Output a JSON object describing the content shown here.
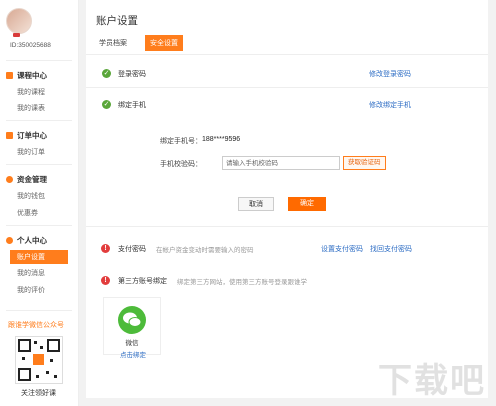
{
  "sidebar": {
    "user_id": "ID:350025688",
    "sections": [
      {
        "title": "课程中心",
        "items": [
          "我的课程",
          "我的课表"
        ]
      },
      {
        "title": "订单中心",
        "items": [
          "我的订单"
        ]
      },
      {
        "title": "资金管理",
        "items": [
          "我的钱包",
          "优惠券"
        ]
      },
      {
        "title": "个人中心",
        "items": [
          "账户设置",
          "我的消息",
          "我的评价"
        ]
      }
    ],
    "active_item": "账户设置",
    "wechat_title": "跟谁学微信公众号",
    "follow_text": "关注领好课"
  },
  "main": {
    "title": "账户设置",
    "tabs": [
      "学员档案",
      "安全设置"
    ],
    "active_tab": "安全设置",
    "login_password": {
      "label": "登录密码",
      "link": "修改登录密码"
    },
    "bind_phone": {
      "label": "绑定手机",
      "link": "修改绑定手机",
      "phone_label": "绑定手机号：",
      "phone_value": "188****9596",
      "code_label": "手机校验码：",
      "code_placeholder": "请输入手机校验码",
      "get_code": "获取验证码",
      "cancel": "取消",
      "confirm": "确定"
    },
    "pay_password": {
      "label": "支付密码",
      "hint": "在帐户资金变动时需要输入的密码",
      "link_set": "设置支付密码",
      "link_recover": "找回支付密码"
    },
    "third_party": {
      "label": "第三方账号绑定",
      "hint": "绑定第三方网站，使用第三方账号登录跟谁学",
      "wechat_label": "微信",
      "bind_link": "点击绑定"
    }
  },
  "watermark": "下载吧",
  "colors": {
    "accent": "#ff7d1c",
    "link": "#2c6cc4",
    "success": "#5aa63a",
    "error": "#e23d3d"
  }
}
